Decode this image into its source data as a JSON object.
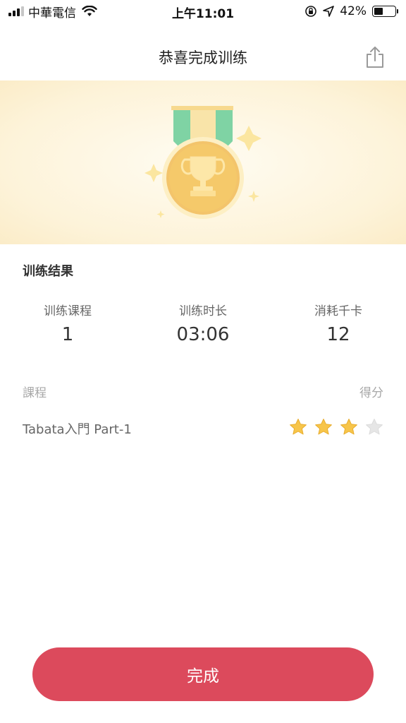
{
  "status_bar": {
    "carrier": "中華電信",
    "time": "上午11:01",
    "battery_percent": "42%",
    "battery_level": 0.42
  },
  "nav": {
    "title": "恭喜完成训练",
    "share_icon": "share-icon"
  },
  "results": {
    "section_title": "训练结果",
    "stats": [
      {
        "label": "训练课程",
        "value": "1"
      },
      {
        "label": "训练时长",
        "value": "03:06"
      },
      {
        "label": "消耗千卡",
        "value": "12"
      }
    ]
  },
  "course_table": {
    "course_header": "課程",
    "score_header": "得分",
    "rows": [
      {
        "name": "Tabata入門 Part-1",
        "stars_filled": 3,
        "stars_total": 4
      }
    ]
  },
  "footer": {
    "done_label": "完成"
  },
  "colors": {
    "accent": "#dc4a5c",
    "medal_gold": "#f5c96a",
    "ribbon_green": "#7fd3a4",
    "star_gold": "#f7c54a",
    "star_empty": "#e6e6e6"
  }
}
